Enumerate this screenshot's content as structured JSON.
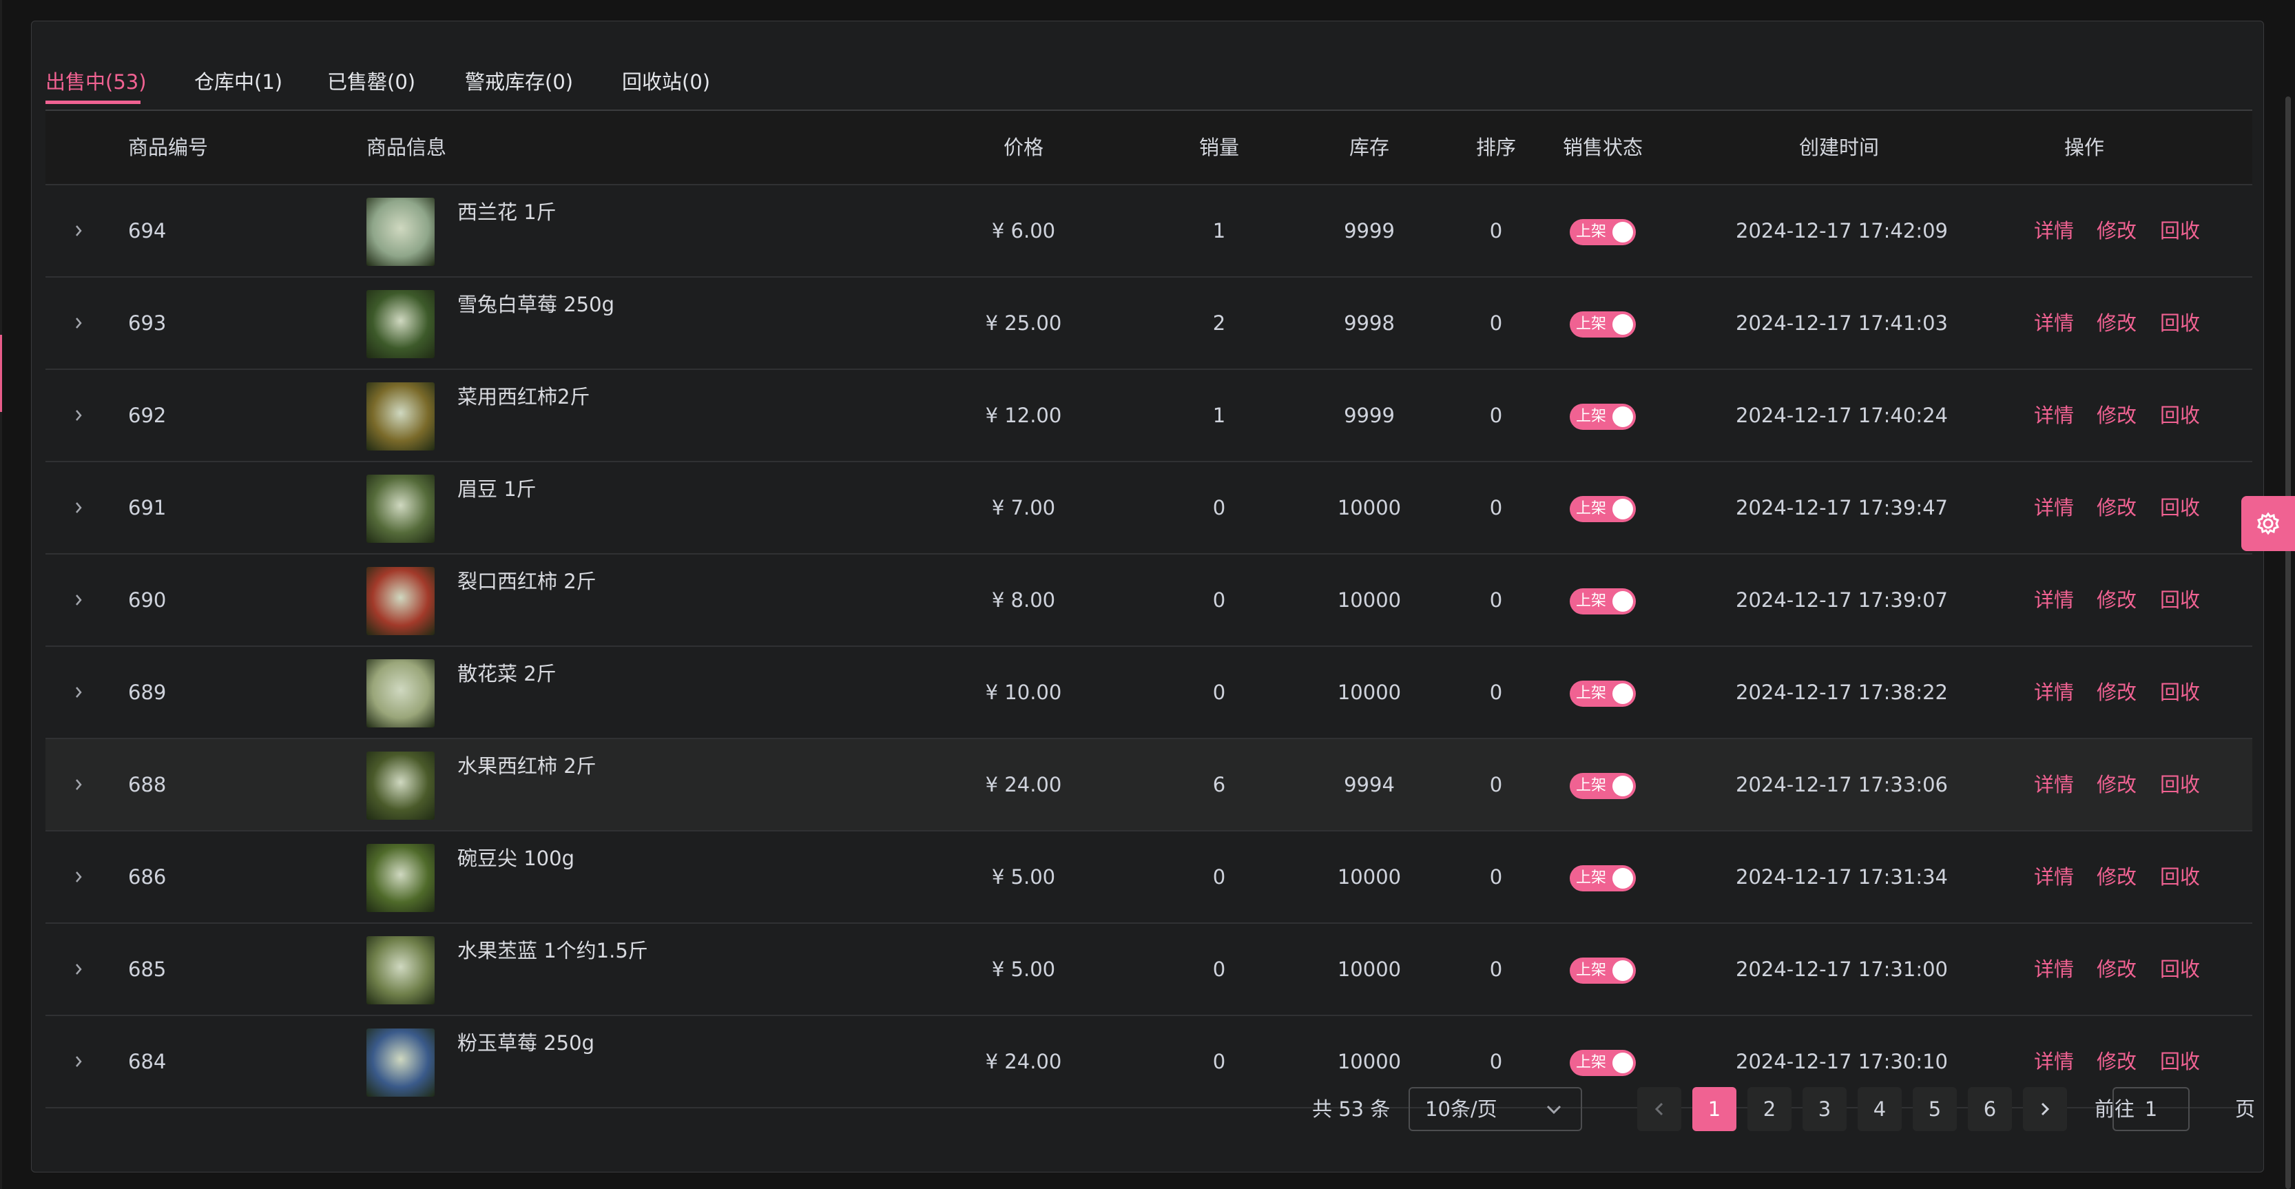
{
  "tabs": [
    {
      "label": "出售中(53)",
      "active": true
    },
    {
      "label": "仓库中(1)"
    },
    {
      "label": "已售罄(0)"
    },
    {
      "label": "警戒库存(0)"
    },
    {
      "label": "回收站(0)"
    }
  ],
  "table": {
    "headers": {
      "id": "商品编号",
      "info": "商品信息",
      "price": "价格",
      "sales": "销量",
      "stock": "库存",
      "sort": "排序",
      "status": "销售状态",
      "created": "创建时间",
      "ops": "操作"
    },
    "actions": {
      "detail": "详情",
      "edit": "修改",
      "recycle": "回收"
    },
    "switch_label": "上架",
    "rows": [
      {
        "id": "694",
        "name": "西兰花 1斤",
        "price": "¥ 6.00",
        "sales": "1",
        "stock": "9999",
        "sort": "0",
        "created": "2024-12-17 17:42:09",
        "thumb_color": "#8fa68a"
      },
      {
        "id": "693",
        "name": "雪兔白草莓 250g",
        "price": "¥ 25.00",
        "sales": "2",
        "stock": "9998",
        "sort": "0",
        "created": "2024-12-17 17:41:03",
        "thumb_color": "#3d5a2a"
      },
      {
        "id": "692",
        "name": "菜用西红柿2斤",
        "price": "¥ 12.00",
        "sales": "1",
        "stock": "9999",
        "sort": "0",
        "created": "2024-12-17 17:40:24",
        "thumb_color": "#7a6a2a"
      },
      {
        "id": "691",
        "name": "眉豆 1斤",
        "price": "¥ 7.00",
        "sales": "0",
        "stock": "10000",
        "sort": "0",
        "created": "2024-12-17 17:39:47",
        "thumb_color": "#556b3a"
      },
      {
        "id": "690",
        "name": "裂口西红柿 2斤",
        "price": "¥ 8.00",
        "sales": "0",
        "stock": "10000",
        "sort": "0",
        "created": "2024-12-17 17:39:07",
        "thumb_color": "#a23a2a"
      },
      {
        "id": "689",
        "name": "散花菜 2斤",
        "price": "¥ 10.00",
        "sales": "0",
        "stock": "10000",
        "sort": "0",
        "created": "2024-12-17 17:38:22",
        "thumb_color": "#9aa67a"
      },
      {
        "id": "688",
        "name": "水果西红柿 2斤",
        "price": "¥ 24.00",
        "sales": "6",
        "stock": "9994",
        "sort": "0",
        "created": "2024-12-17 17:33:06",
        "thumb_color": "#4a5a2a"
      },
      {
        "id": "686",
        "name": "碗豆尖 100g",
        "price": "¥ 5.00",
        "sales": "0",
        "stock": "10000",
        "sort": "0",
        "created": "2024-12-17 17:31:34",
        "thumb_color": "#4f6a2a"
      },
      {
        "id": "685",
        "name": "水果苤蓝 1个约1.5斤",
        "price": "¥ 5.00",
        "sales": "0",
        "stock": "10000",
        "sort": "0",
        "created": "2024-12-17 17:31:00",
        "thumb_color": "#6f7f4a"
      },
      {
        "id": "684",
        "name": "粉玉草莓 250g",
        "price": "¥ 24.00",
        "sales": "0",
        "stock": "10000",
        "sort": "0",
        "created": "2024-12-17 17:30:10",
        "thumb_color": "#3a5a8a"
      }
    ]
  },
  "pagination": {
    "total": "共 53 条",
    "page_size": "10条/页",
    "pages": [
      "1",
      "2",
      "3",
      "4",
      "5",
      "6"
    ],
    "current": "1",
    "goto_label": "前往",
    "goto_value": "1",
    "page_suffix": "页"
  },
  "colors": {
    "accent": "#f06292"
  }
}
